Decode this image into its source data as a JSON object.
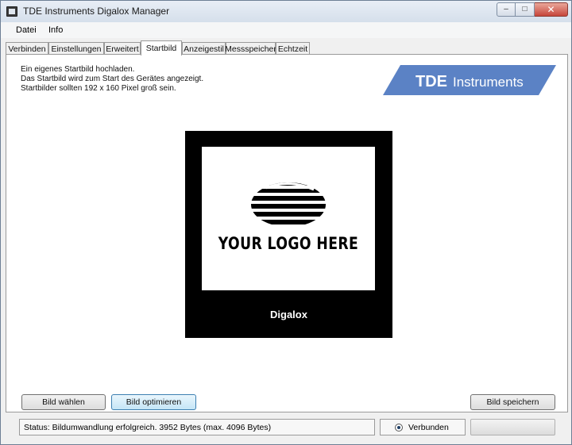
{
  "window": {
    "title": "TDE Instruments Digalox Manager",
    "controls": {
      "minimize": "–",
      "maximize": "□",
      "close": "✕"
    }
  },
  "menu": [
    {
      "label": "Datei"
    },
    {
      "label": "Info"
    }
  ],
  "tabs": [
    {
      "label": "Verbinden"
    },
    {
      "label": "Einstellungen"
    },
    {
      "label": "Erweitert"
    },
    {
      "label": "Startbild",
      "active": true
    },
    {
      "label": "Anzeigestil"
    },
    {
      "label": "Messspeicher"
    },
    {
      "label": "Echtzeit"
    }
  ],
  "panel": {
    "description": [
      "Ein eigenes Startbild hochladen.",
      "Das Startbild wird zum Start des Gerätes angezeigt.",
      "Startbilder sollten 192 x 160 Pixel groß sein."
    ],
    "brand": {
      "bold": "TDE",
      "rest": "Instruments",
      "color": "#5b82c5"
    },
    "preview": {
      "logo_text": "YOUR LOGO HERE",
      "device_name": "Digalox"
    }
  },
  "buttons": {
    "choose": "Bild wählen",
    "optimize": "Bild optimieren",
    "save": "Bild speichern"
  },
  "statusbar": {
    "status_text": "Status: Bildumwandlung erfolgreich.  3952 Bytes (max. 4096 Bytes)",
    "connection_label": "Verbunden",
    "connected": true
  }
}
